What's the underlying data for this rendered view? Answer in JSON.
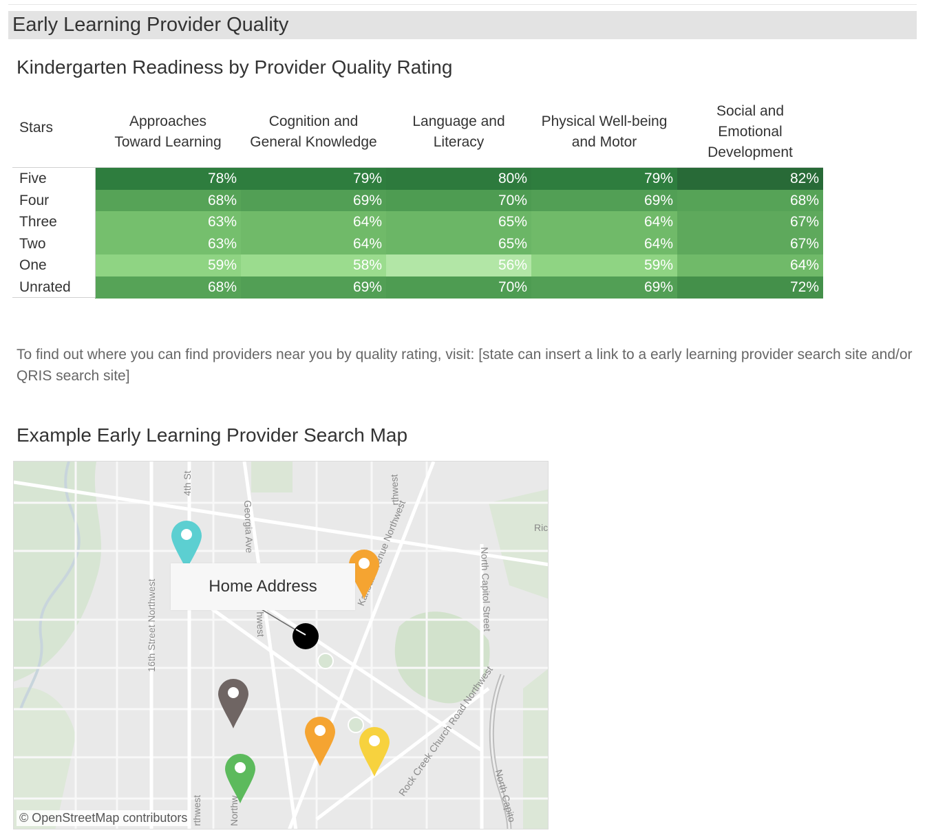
{
  "header": {
    "title": "Early Learning Provider Quality"
  },
  "readiness": {
    "title": "Kindergarten Readiness by Provider Quality Rating",
    "stars_header": "Stars",
    "columns": [
      [
        "Approaches",
        "Toward Learning"
      ],
      [
        "Cognition and",
        "General Knowledge"
      ],
      [
        "Language and",
        "Literacy"
      ],
      [
        "Physical Well-being",
        "and Motor"
      ],
      [
        "Social and",
        "Emotional",
        "Development"
      ]
    ],
    "rows": [
      {
        "label": "Five",
        "values": [
          "78%",
          "79%",
          "80%",
          "79%",
          "82%"
        ],
        "colors": [
          "#2e7d3e",
          "#2e7d3e",
          "#2d7a3d",
          "#2e7d3e",
          "#286a37"
        ]
      },
      {
        "label": "Four",
        "values": [
          "68%",
          "69%",
          "70%",
          "69%",
          "68%"
        ],
        "colors": [
          "#56a357",
          "#529f55",
          "#4e9c52",
          "#529f55",
          "#56a357"
        ]
      },
      {
        "label": "Three",
        "values": [
          "63%",
          "64%",
          "65%",
          "64%",
          "67%"
        ],
        "colors": [
          "#75bf6d",
          "#70ba69",
          "#6bb666",
          "#70ba69",
          "#5ea95c"
        ]
      },
      {
        "label": "Two",
        "values": [
          "63%",
          "64%",
          "65%",
          "64%",
          "67%"
        ],
        "colors": [
          "#75bf6d",
          "#70ba69",
          "#6bb666",
          "#70ba69",
          "#5ea95c"
        ]
      },
      {
        "label": "One",
        "values": [
          "59%",
          "58%",
          "56%",
          "59%",
          "64%"
        ],
        "colors": [
          "#8fd483",
          "#9bdc8e",
          "#b2e6a6",
          "#8fd483",
          "#70ba69"
        ]
      },
      {
        "label": "Unrated",
        "values": [
          "68%",
          "69%",
          "70%",
          "69%",
          "72%"
        ],
        "colors": [
          "#56a357",
          "#529f55",
          "#4e9c52",
          "#529f55",
          "#44904a"
        ]
      }
    ]
  },
  "info_text": "To find out where you can find providers near you by quality rating, visit: [state can insert a link to a early learning provider search site and/or QRIS search site]",
  "map": {
    "title": "Example Early Learning Provider Search Map",
    "tooltip": "Home Address",
    "attribution": "© OpenStreetMap contributors",
    "road_labels": {
      "r1": "4th St",
      "r2": "Georgia Ave",
      "r3": "rthwest",
      "r4": "Kansas Avenue Northwest",
      "r5": "Ric",
      "r6": "16th Street Northwest",
      "r7": "hwest",
      "r8": "North Capitol Street",
      "r9": "Rock Creek Church Road Northwest",
      "r10": "North Capito",
      "r11": "rthwest",
      "r12": "Northw"
    },
    "pin_colors": {
      "teal": "#5ccfd1",
      "orange": "#f5a431",
      "gray": "#6f6563",
      "green": "#5cba5c",
      "yellow": "#f7d23e",
      "home": "#000000"
    }
  }
}
